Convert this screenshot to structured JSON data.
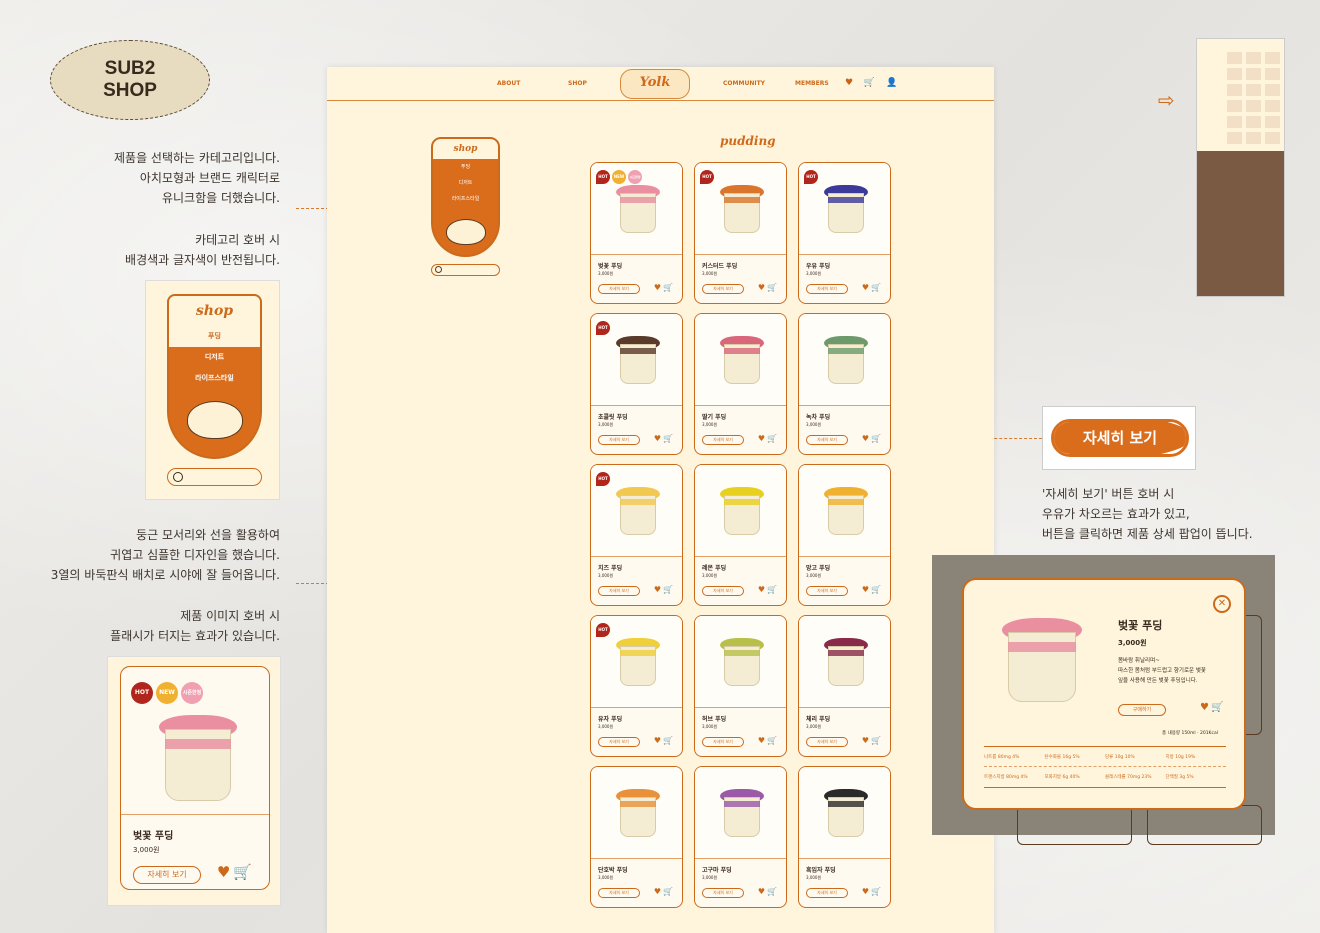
{
  "header": {
    "line1": "SUB2",
    "line2": "SHOP"
  },
  "descriptions": {
    "category": "제품을 선택하는 카테고리입니다.\n아치모형과 브랜드 캐릭터로\n유니크함을 더했습니다.",
    "hover": "카테고리 호버 시\n배경색과 글자색이 반전됩니다.",
    "grid": "둥근 모서리와 선을 활용하여\n귀엽고 심플한 디자인을 했습니다.\n3열의 바둑판식 배치로 시야에 잘 들어옵니다.",
    "image_hover": "제품 이미지 호버 시\n플래시가 터지는 효과가 있습니다.",
    "button_hover": "'자세히 보기' 버튼 호버 시\n우유가 차오르는 효과가 있고,\n버튼을 클릭하면 제품 상세 팝업이 뜹니다."
  },
  "nav": {
    "about": "ABOUT",
    "shop": "SHOP",
    "logo": "Yolk",
    "community": "COMMUNITY",
    "members": "MEMBERS",
    "icons": "♥ 🛒 👤"
  },
  "category": {
    "title": "shop",
    "items": [
      "푸딩",
      "디저트",
      "라이프스타일"
    ]
  },
  "section_title": "pudding",
  "card_button": "자세히 보기",
  "card_icons": "♥🛒",
  "badges": {
    "hot": "HOT",
    "new": "NEW",
    "limited": "시즌한정"
  },
  "products": [
    {
      "name": "벚꽃 푸딩",
      "price": "3,000원",
      "lid": "#e98fa0",
      "hot": true,
      "new": true,
      "limited": true
    },
    {
      "name": "커스터드 푸딩",
      "price": "3,000원",
      "lid": "#d9762c",
      "hot": true
    },
    {
      "name": "우유 푸딩",
      "price": "3,000원",
      "lid": "#3b3a9a",
      "hot": true
    },
    {
      "name": "초콜릿 푸딩",
      "price": "3,000원",
      "lid": "#5a3a2a",
      "hot": true
    },
    {
      "name": "딸기 푸딩",
      "price": "3,000원",
      "lid": "#d9667a"
    },
    {
      "name": "녹차 푸딩",
      "price": "3,000원",
      "lid": "#6d9a6a"
    },
    {
      "name": "치즈 푸딩",
      "price": "3,000원",
      "lid": "#f1c850",
      "hot": true
    },
    {
      "name": "레몬 푸딩",
      "price": "3,000원",
      "lid": "#e8d020"
    },
    {
      "name": "망고 푸딩",
      "price": "3,000원",
      "lid": "#f0b030"
    },
    {
      "name": "유자 푸딩",
      "price": "3,000원",
      "lid": "#f0d03a",
      "hot": true
    },
    {
      "name": "허브 푸딩",
      "price": "3,000원",
      "lid": "#b9c04a"
    },
    {
      "name": "체리 푸딩",
      "price": "3,000원",
      "lid": "#8a2a4a"
    },
    {
      "name": "단호박 푸딩",
      "price": "3,000원",
      "lid": "#e8913a"
    },
    {
      "name": "고구마 푸딩",
      "price": "3,000원",
      "lid": "#9a5aa8"
    },
    {
      "name": "흑임자 푸딩",
      "price": "3,000원",
      "lid": "#2a2a2a"
    }
  ],
  "zoom_card": {
    "name": "벚꽃 푸딩",
    "price": "3,000원",
    "button": "자세히 보기"
  },
  "button_zoom": {
    "label": "자세히 보기"
  },
  "popup": {
    "title": "벚꽃 푸딩",
    "price": "3,000원",
    "description": "봄바람 휘날리며~\n따스한 봄처럼 부드럽고 향기로운 벚꽃\n잎을 사용해 만든 벚꽃 푸딩입니다.",
    "button": "구매하기",
    "kcal": "총 내용량 150ml · 201Kcal",
    "nutrition": [
      [
        "나트륨 80mg 4%",
        "탄수화물 16g 5%",
        "당류 10g 10%",
        "지방 10g 19%"
      ],
      [
        "트랜스지방 80mg 4%",
        "포화지방 6g 40%",
        "콜레스테롤 70mg 23%",
        "단백질 3g 5%"
      ]
    ],
    "close": "✕"
  },
  "colors": {
    "accent": "#cc6a1c",
    "bg": "#fef5dc",
    "hot": "#b0261c"
  }
}
